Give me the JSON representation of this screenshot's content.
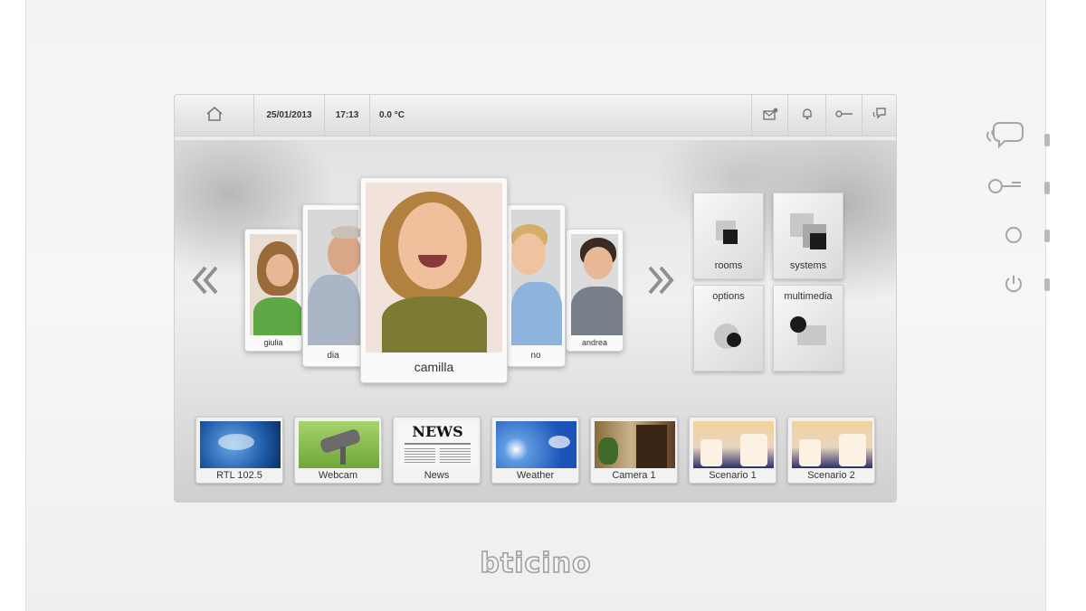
{
  "status_bar": {
    "date": "25/01/2013",
    "time": "17:13",
    "temperature": "0.0 °C",
    "left_icon": "home-icon",
    "right_icons": [
      "envelope-icon",
      "bell-icon",
      "key-icon",
      "speech-icon"
    ]
  },
  "carousel": {
    "contacts": [
      {
        "name": "giulia"
      },
      {
        "name": "dia"
      },
      {
        "name": "camilla"
      },
      {
        "name": "no"
      },
      {
        "name": "andrea"
      }
    ],
    "prev_icon": "chevron-double-left-icon",
    "next_icon": "chevron-double-right-icon"
  },
  "menu": {
    "tiles": [
      {
        "label": "rooms"
      },
      {
        "label": "systems"
      },
      {
        "label": "options"
      },
      {
        "label": "multimedia"
      }
    ]
  },
  "shortcuts": [
    {
      "label": "RTL 102.5"
    },
    {
      "label": "Webcam"
    },
    {
      "label": "News",
      "thumb_text": "NEWS"
    },
    {
      "label": "Weather"
    },
    {
      "label": "Camera 1"
    },
    {
      "label": "Scenario 1"
    },
    {
      "label": "Scenario 2"
    }
  ],
  "brand": {
    "logo_text": "bticino"
  },
  "side_buttons": [
    "chat-icon",
    "key-icon",
    "circle-icon",
    "power-icon"
  ]
}
